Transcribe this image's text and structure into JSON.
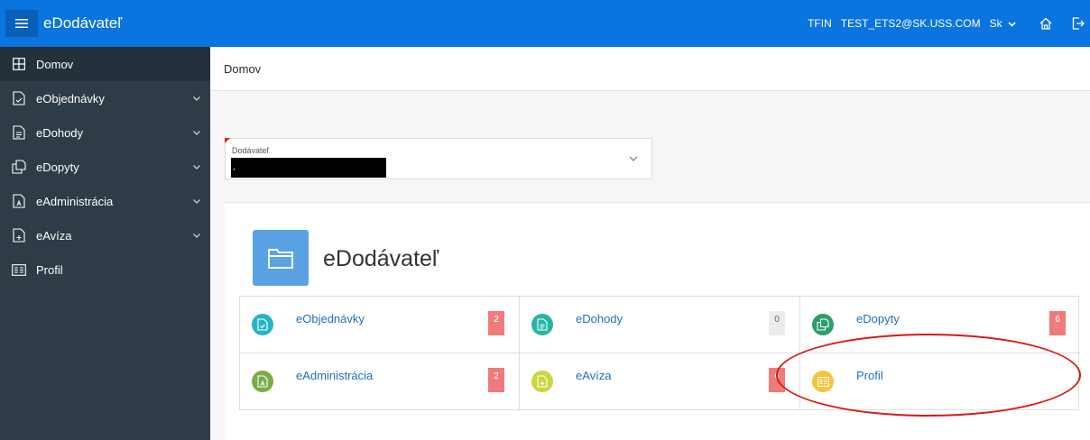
{
  "header": {
    "app_name": "eDodávateľ",
    "org": "TFIN",
    "user": "TEST_ETS2@SK.USS.COM",
    "language": "Sk"
  },
  "sidebar": {
    "items": [
      {
        "label": "Domov",
        "icon": "grid-icon",
        "expandable": false,
        "active": true
      },
      {
        "label": "eObjednávky",
        "icon": "document-check-icon",
        "expandable": true
      },
      {
        "label": "eDohody",
        "icon": "document-icon",
        "expandable": true
      },
      {
        "label": "eDopyty",
        "icon": "documents-copy-icon",
        "expandable": true
      },
      {
        "label": "eAdministrácia",
        "icon": "document-user-icon",
        "expandable": true
      },
      {
        "label": "eAvíza",
        "icon": "document-plus-icon",
        "expandable": true
      },
      {
        "label": "Profil",
        "icon": "id-card-icon",
        "expandable": false
      }
    ]
  },
  "breadcrumb": "Domov",
  "supplier_select": {
    "label": "Dodávateľ",
    "value": ","
  },
  "dashboard": {
    "title": "eDodávateľ",
    "tiles": [
      {
        "label": "eObjednávky",
        "count": "2",
        "color": "#26b5c6",
        "icon": "document-check-icon",
        "badge": "red"
      },
      {
        "label": "eDohody",
        "count": "0",
        "color": "#26b5a5",
        "icon": "document-icon",
        "badge": "gray"
      },
      {
        "label": "eDopyty",
        "count": "6",
        "color": "#2e9e6a",
        "icon": "documents-copy-icon",
        "badge": "red"
      },
      {
        "label": "eAdministrácia",
        "count": "2",
        "color": "#78ad4a",
        "icon": "document-user-icon",
        "badge": "red"
      },
      {
        "label": "eAvíza",
        "count": "6",
        "color": "#cbd640",
        "icon": "document-plus-icon",
        "badge": "red"
      },
      {
        "label": "Profil",
        "count": "",
        "color": "#f3c43c",
        "icon": "id-card-icon",
        "badge": "none"
      }
    ]
  },
  "colors": {
    "topbar": "#0a74df",
    "sidebar": "#2f3b47",
    "annotation": "#e01414"
  }
}
